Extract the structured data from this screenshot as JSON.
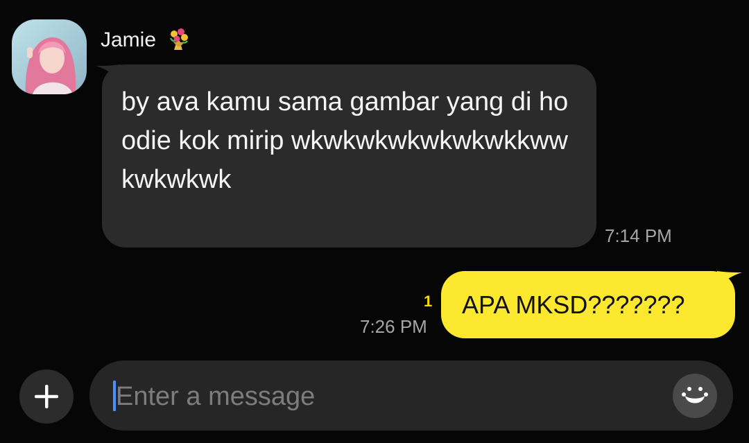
{
  "chat": {
    "sender": {
      "name": "Jamie",
      "name_emoji": "bouquet-icon"
    },
    "incoming_message": {
      "text": "by ava kamu sama gambar yang di hoodie kok mirip wkwkwkwkwkwkwkkwwkwkwkwk",
      "time": "7:14 PM"
    },
    "outgoing_message": {
      "text": "APA MKSD???????",
      "unread_count": "1",
      "time": "7:26 PM"
    }
  },
  "composer": {
    "placeholder": "Enter a message",
    "plus_icon": "plus-icon",
    "emoji_icon": "smiley-icon"
  },
  "colors": {
    "background": "#060606",
    "incoming_bubble": "#2b2b2b",
    "outgoing_bubble": "#fde830",
    "unread_badge": "#f5d90a",
    "caret": "#4a90ff"
  }
}
